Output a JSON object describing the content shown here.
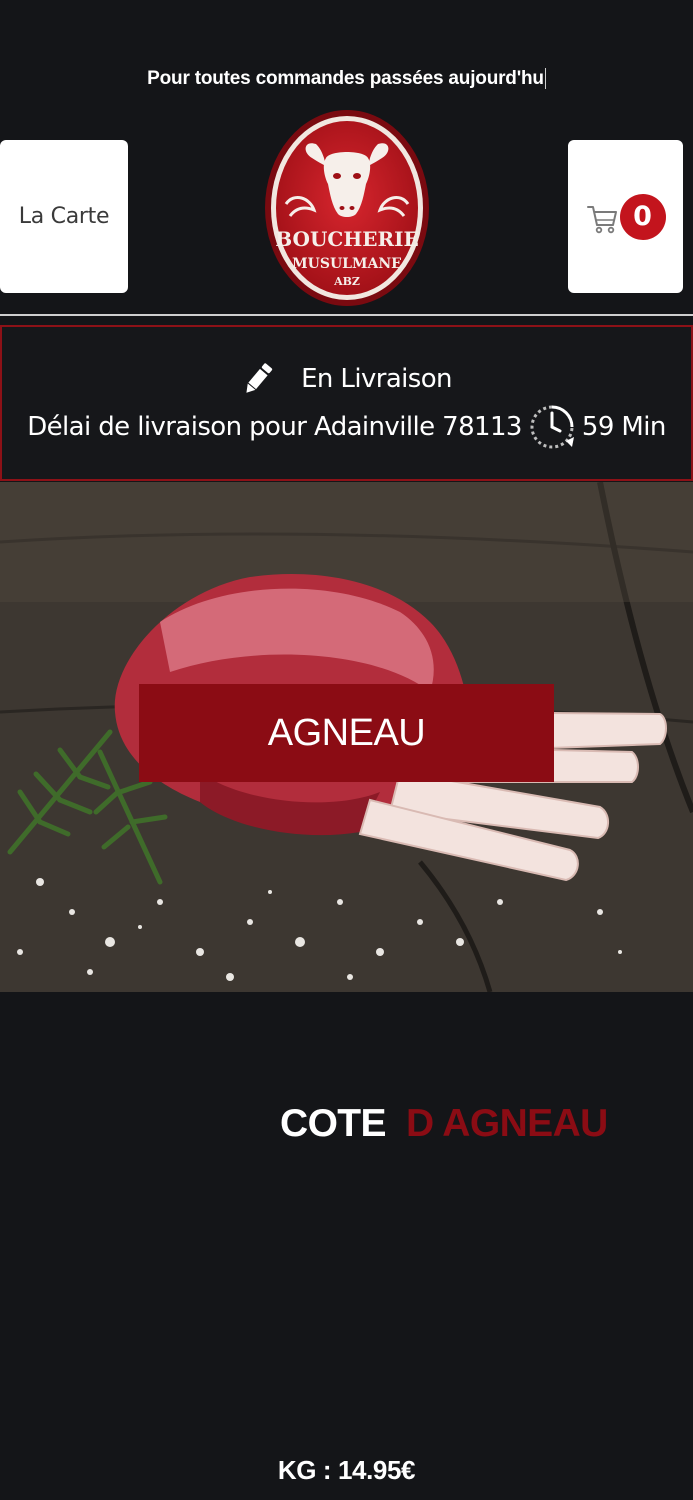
{
  "banner": {
    "text": "Pour toutes commandes passées aujourd'hu"
  },
  "header": {
    "menu_label": "La Carte",
    "cart_count": "0",
    "logo": {
      "line1": "BOUCHERIE",
      "line2": "MUSULMANE",
      "line3": "ABZ",
      "icon": "bull-head-logo"
    }
  },
  "delivery": {
    "mode_icon": "pencil-icon",
    "mode_label": "En Livraison",
    "delay_label": "Délai de livraison pour Adainville 78113",
    "delay_icon": "clock-icon",
    "delay_value": "59 Min"
  },
  "hero": {
    "category_label": "AGNEAU"
  },
  "product": {
    "title_part1": "COTE",
    "title_part2": "D AGNEAU",
    "price": "KG : 14.95€"
  },
  "colors": {
    "background": "#141518",
    "accent_red": "#8b0c14",
    "badge_red": "#c3141d",
    "card_white": "#ffffff"
  }
}
